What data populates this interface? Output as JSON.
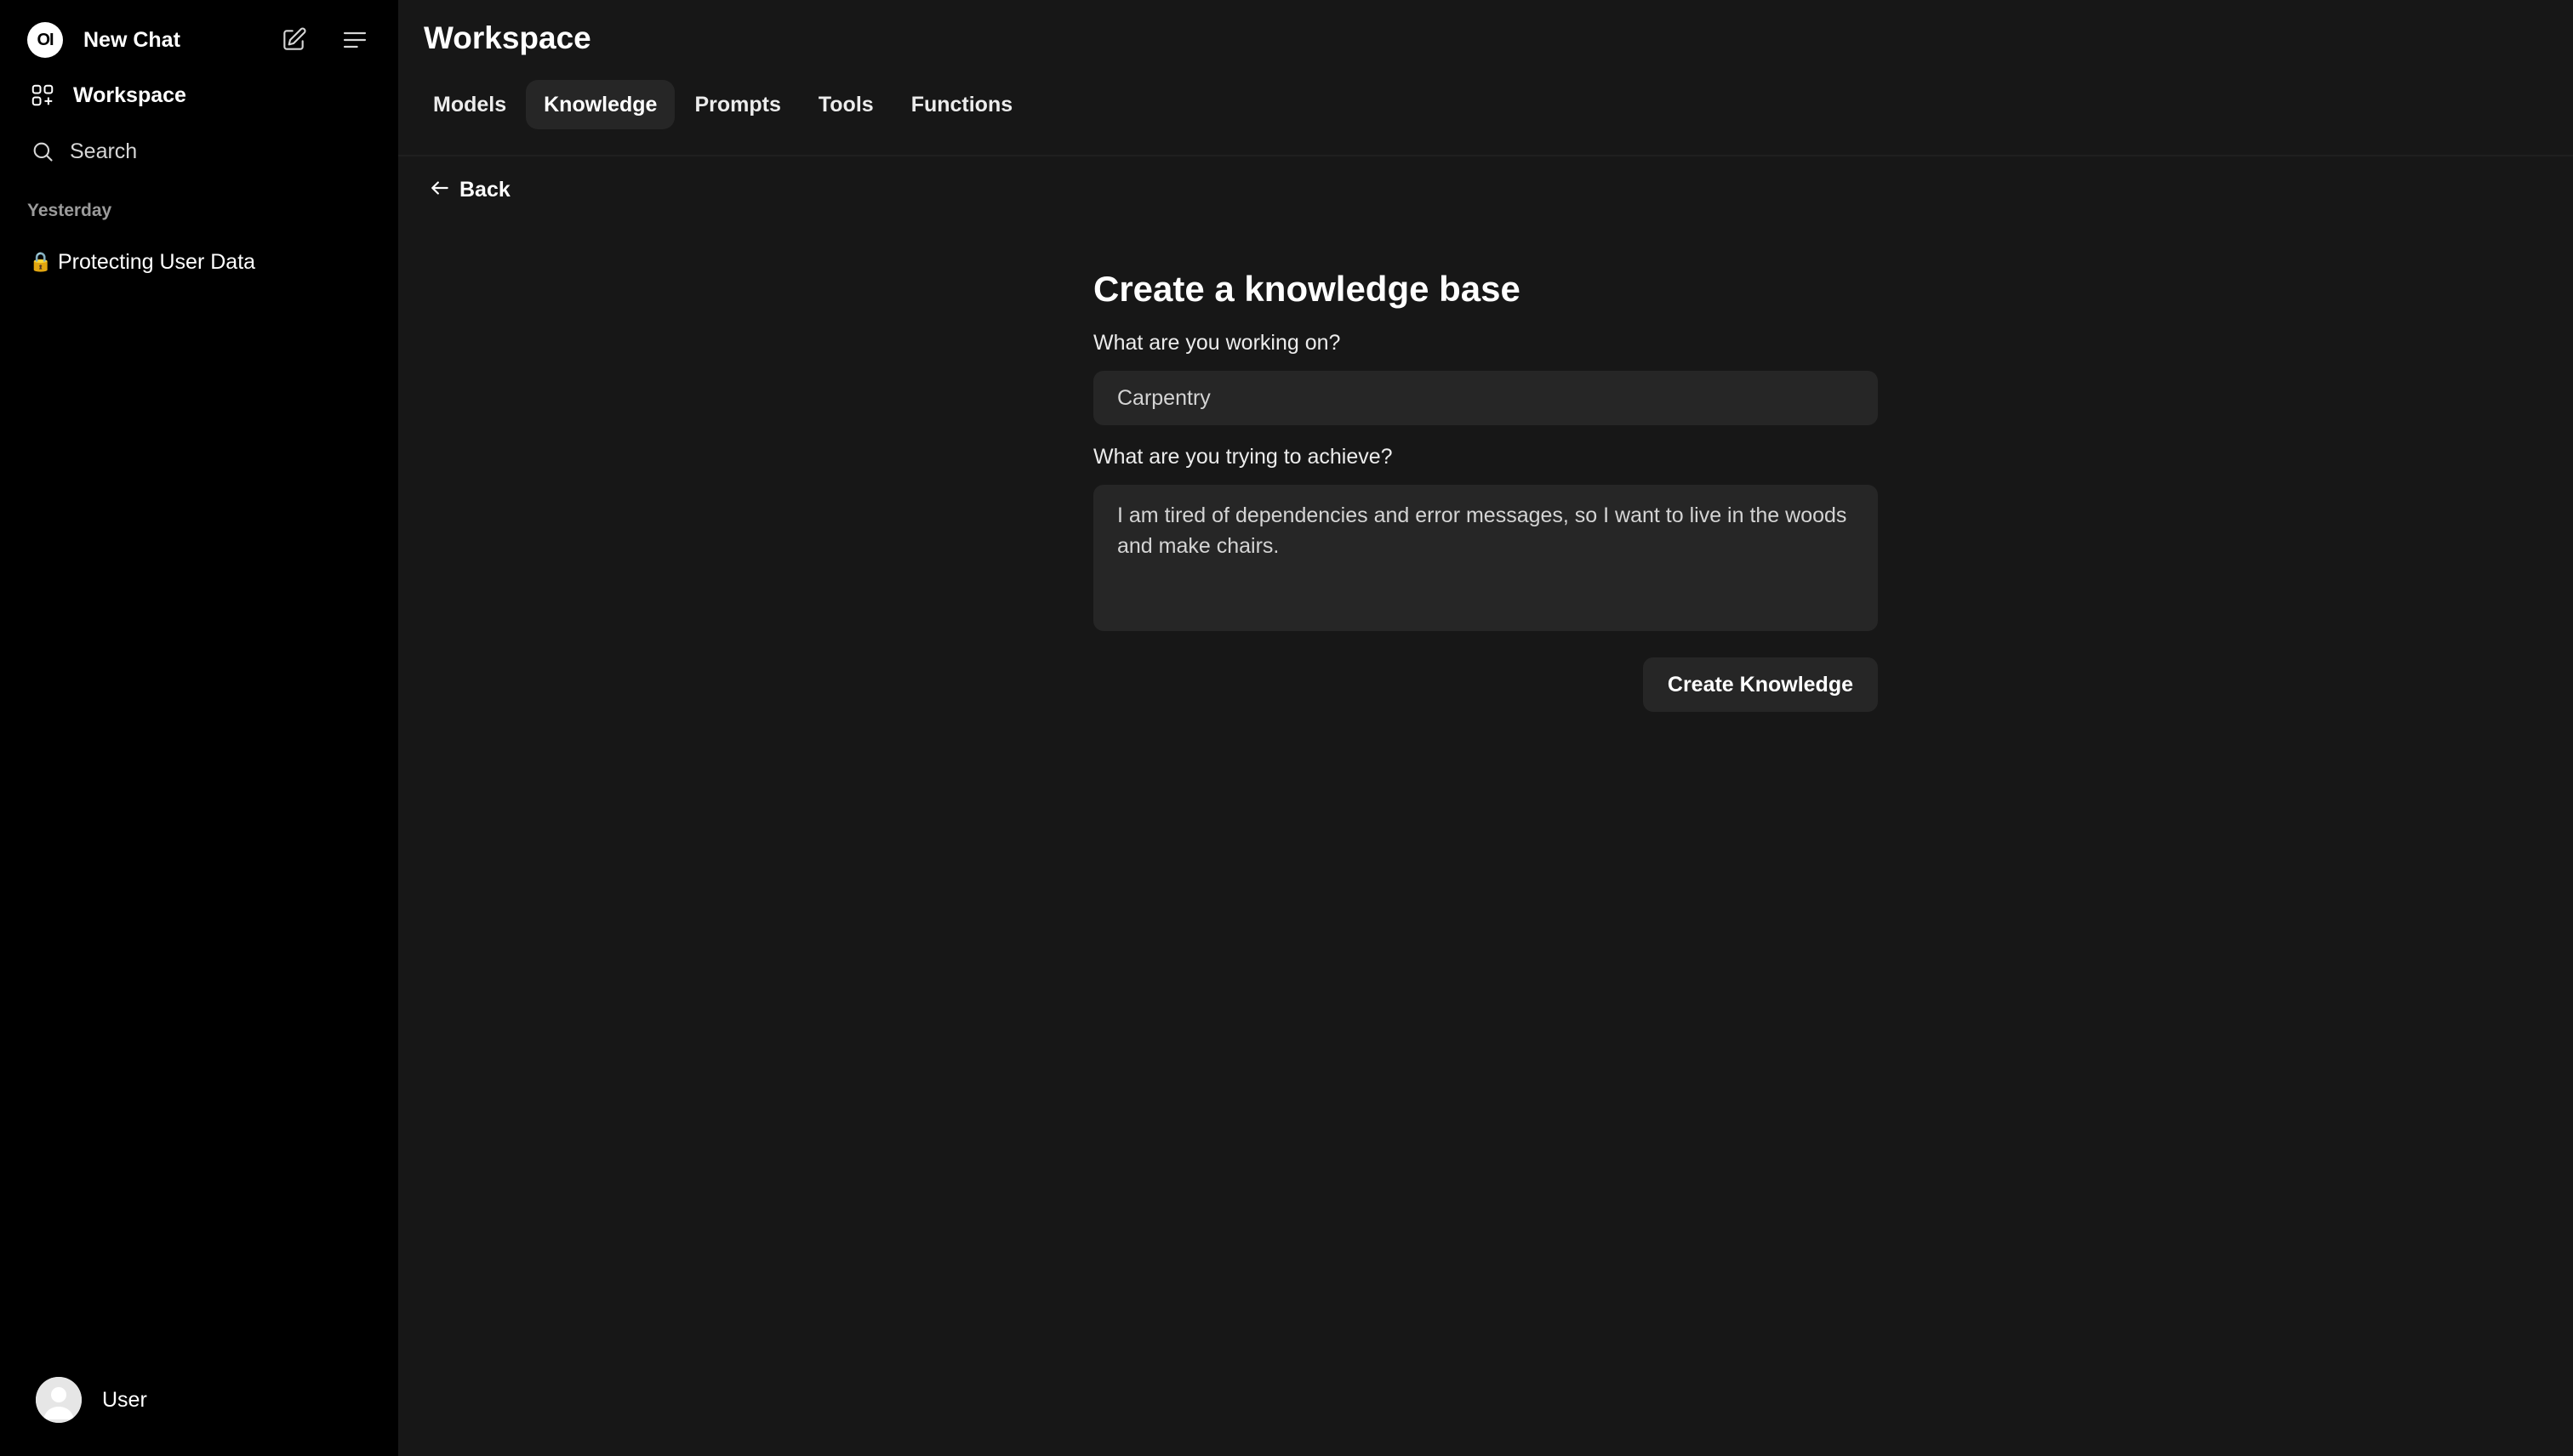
{
  "sidebar": {
    "logo_text": "OI",
    "new_chat_label": "New Chat",
    "workspace_label": "Workspace",
    "search_label": "Search",
    "section_label": "Yesterday",
    "chat_lock": "🔒",
    "chat_title": "Protecting User Data",
    "user_label": "User"
  },
  "header": {
    "title": "Workspace",
    "tabs": [
      {
        "label": "Models"
      },
      {
        "label": "Knowledge"
      },
      {
        "label": "Prompts"
      },
      {
        "label": "Tools"
      },
      {
        "label": "Functions"
      }
    ],
    "active_tab": "Knowledge"
  },
  "back_label": "Back",
  "form": {
    "title": "Create a knowledge base",
    "name_label": "What are you working on?",
    "name_value": "Carpentry",
    "description_label": "What are you trying to achieve?",
    "description_value": "I am tired of dependencies and error messages, so I want to live in the woods and make chairs.",
    "submit_label": "Create Knowledge"
  },
  "colors": {
    "sidebar_bg": "#000000",
    "main_bg": "#171717",
    "field_bg": "#262626",
    "text": "#ececec"
  }
}
